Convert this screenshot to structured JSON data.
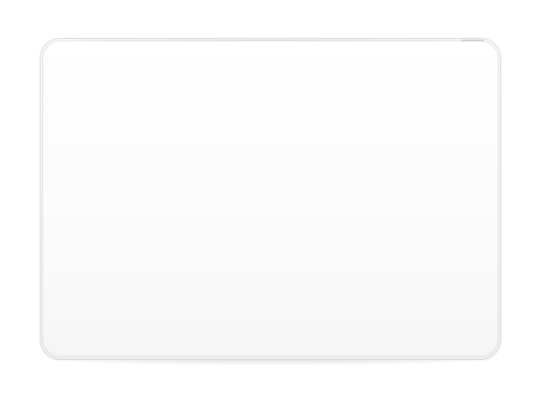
{
  "product": {
    "name": "trackpad",
    "colors": {
      "background": "#ffffff",
      "surface": "#fbfbfb",
      "edge": "#d8d8da"
    },
    "icons": []
  }
}
